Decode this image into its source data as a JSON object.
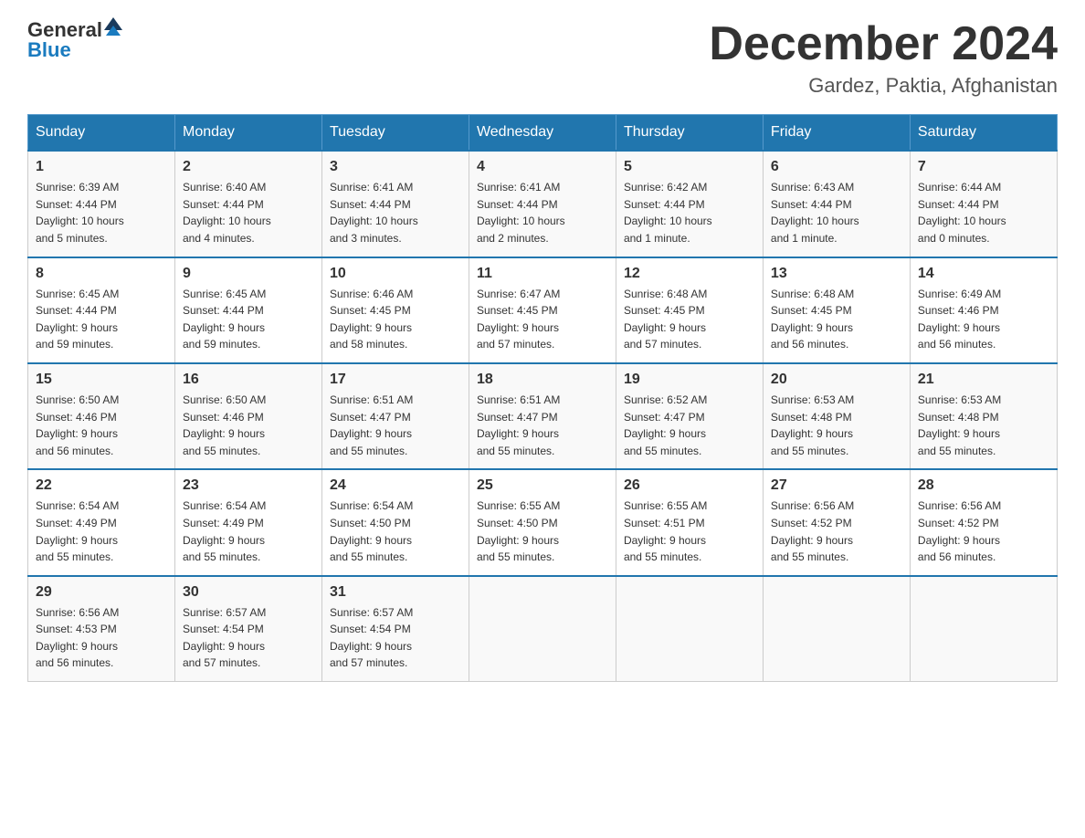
{
  "header": {
    "logo": {
      "general": "General",
      "blue": "Blue"
    },
    "title": "December 2024",
    "location": "Gardez, Paktia, Afghanistan"
  },
  "days_of_week": [
    "Sunday",
    "Monday",
    "Tuesday",
    "Wednesday",
    "Thursday",
    "Friday",
    "Saturday"
  ],
  "weeks": [
    [
      {
        "day": "1",
        "sunrise": "6:39 AM",
        "sunset": "4:44 PM",
        "daylight": "10 hours and 5 minutes."
      },
      {
        "day": "2",
        "sunrise": "6:40 AM",
        "sunset": "4:44 PM",
        "daylight": "10 hours and 4 minutes."
      },
      {
        "day": "3",
        "sunrise": "6:41 AM",
        "sunset": "4:44 PM",
        "daylight": "10 hours and 3 minutes."
      },
      {
        "day": "4",
        "sunrise": "6:41 AM",
        "sunset": "4:44 PM",
        "daylight": "10 hours and 2 minutes."
      },
      {
        "day": "5",
        "sunrise": "6:42 AM",
        "sunset": "4:44 PM",
        "daylight": "10 hours and 1 minute."
      },
      {
        "day": "6",
        "sunrise": "6:43 AM",
        "sunset": "4:44 PM",
        "daylight": "10 hours and 1 minute."
      },
      {
        "day": "7",
        "sunrise": "6:44 AM",
        "sunset": "4:44 PM",
        "daylight": "10 hours and 0 minutes."
      }
    ],
    [
      {
        "day": "8",
        "sunrise": "6:45 AM",
        "sunset": "4:44 PM",
        "daylight": "9 hours and 59 minutes."
      },
      {
        "day": "9",
        "sunrise": "6:45 AM",
        "sunset": "4:44 PM",
        "daylight": "9 hours and 59 minutes."
      },
      {
        "day": "10",
        "sunrise": "6:46 AM",
        "sunset": "4:45 PM",
        "daylight": "9 hours and 58 minutes."
      },
      {
        "day": "11",
        "sunrise": "6:47 AM",
        "sunset": "4:45 PM",
        "daylight": "9 hours and 57 minutes."
      },
      {
        "day": "12",
        "sunrise": "6:48 AM",
        "sunset": "4:45 PM",
        "daylight": "9 hours and 57 minutes."
      },
      {
        "day": "13",
        "sunrise": "6:48 AM",
        "sunset": "4:45 PM",
        "daylight": "9 hours and 56 minutes."
      },
      {
        "day": "14",
        "sunrise": "6:49 AM",
        "sunset": "4:46 PM",
        "daylight": "9 hours and 56 minutes."
      }
    ],
    [
      {
        "day": "15",
        "sunrise": "6:50 AM",
        "sunset": "4:46 PM",
        "daylight": "9 hours and 56 minutes."
      },
      {
        "day": "16",
        "sunrise": "6:50 AM",
        "sunset": "4:46 PM",
        "daylight": "9 hours and 55 minutes."
      },
      {
        "day": "17",
        "sunrise": "6:51 AM",
        "sunset": "4:47 PM",
        "daylight": "9 hours and 55 minutes."
      },
      {
        "day": "18",
        "sunrise": "6:51 AM",
        "sunset": "4:47 PM",
        "daylight": "9 hours and 55 minutes."
      },
      {
        "day": "19",
        "sunrise": "6:52 AM",
        "sunset": "4:47 PM",
        "daylight": "9 hours and 55 minutes."
      },
      {
        "day": "20",
        "sunrise": "6:53 AM",
        "sunset": "4:48 PM",
        "daylight": "9 hours and 55 minutes."
      },
      {
        "day": "21",
        "sunrise": "6:53 AM",
        "sunset": "4:48 PM",
        "daylight": "9 hours and 55 minutes."
      }
    ],
    [
      {
        "day": "22",
        "sunrise": "6:54 AM",
        "sunset": "4:49 PM",
        "daylight": "9 hours and 55 minutes."
      },
      {
        "day": "23",
        "sunrise": "6:54 AM",
        "sunset": "4:49 PM",
        "daylight": "9 hours and 55 minutes."
      },
      {
        "day": "24",
        "sunrise": "6:54 AM",
        "sunset": "4:50 PM",
        "daylight": "9 hours and 55 minutes."
      },
      {
        "day": "25",
        "sunrise": "6:55 AM",
        "sunset": "4:50 PM",
        "daylight": "9 hours and 55 minutes."
      },
      {
        "day": "26",
        "sunrise": "6:55 AM",
        "sunset": "4:51 PM",
        "daylight": "9 hours and 55 minutes."
      },
      {
        "day": "27",
        "sunrise": "6:56 AM",
        "sunset": "4:52 PM",
        "daylight": "9 hours and 55 minutes."
      },
      {
        "day": "28",
        "sunrise": "6:56 AM",
        "sunset": "4:52 PM",
        "daylight": "9 hours and 56 minutes."
      }
    ],
    [
      {
        "day": "29",
        "sunrise": "6:56 AM",
        "sunset": "4:53 PM",
        "daylight": "9 hours and 56 minutes."
      },
      {
        "day": "30",
        "sunrise": "6:57 AM",
        "sunset": "4:54 PM",
        "daylight": "9 hours and 57 minutes."
      },
      {
        "day": "31",
        "sunrise": "6:57 AM",
        "sunset": "4:54 PM",
        "daylight": "9 hours and 57 minutes."
      },
      null,
      null,
      null,
      null
    ]
  ],
  "labels": {
    "sunrise": "Sunrise:",
    "sunset": "Sunset:",
    "daylight": "Daylight:"
  }
}
